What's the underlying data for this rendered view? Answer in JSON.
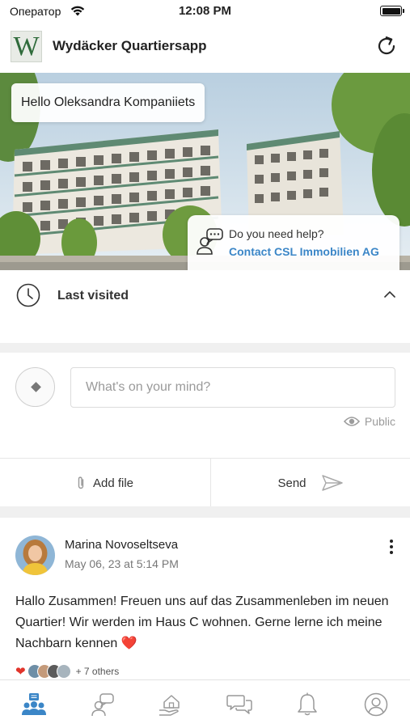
{
  "status_bar": {
    "carrier": "Оператор",
    "time": "12:08 PM"
  },
  "app": {
    "title": "Wydäcker Quartiersapp",
    "logo_letter": "W"
  },
  "hero": {
    "greeting": "Hello Oleksandra Kompaniiets",
    "help_question": "Do you need help?",
    "help_contact": "Contact CSL Immobilien AG"
  },
  "last_visited": {
    "label": "Last visited"
  },
  "composer": {
    "placeholder": "What's on your mind?",
    "visibility": "Public",
    "add_file_label": "Add file",
    "send_label": "Send"
  },
  "post": {
    "author": "Marina Novoseltseva",
    "date": "May 06, 23 at 5:14 PM",
    "text": "Hallo Zusammen! Freuen uns auf das Zusammenleben im neuen Quartier! Wir werden im Haus C wohnen. Gerne lerne ich meine Nachbarn kennen ❤️",
    "reaction_icon": "heart-icon",
    "others": "+ 7 others"
  },
  "tabbar": {
    "items": [
      "community-icon",
      "chat-support-icon",
      "home-hand-icon",
      "messages-icon",
      "bell-icon",
      "profile-icon"
    ],
    "active_index": 0
  },
  "colors": {
    "accent_blue": "#3b86c7",
    "heart_red": "#e1342b",
    "logo_green": "#2f6b3b"
  }
}
